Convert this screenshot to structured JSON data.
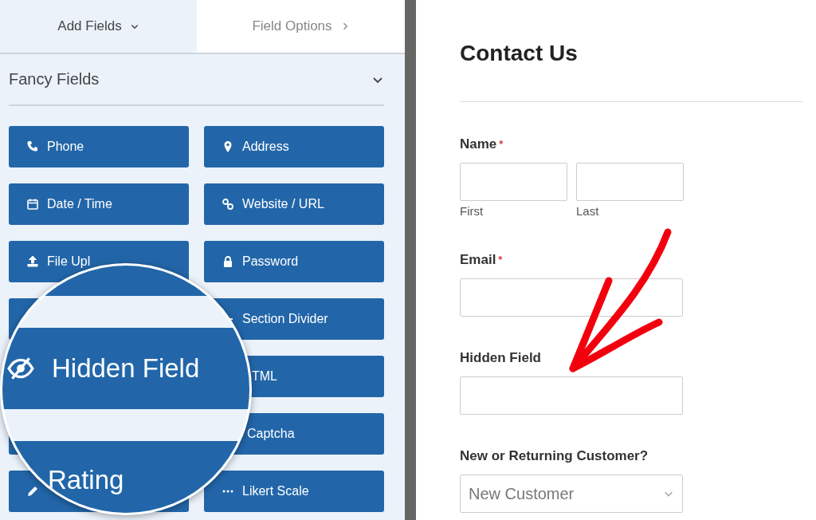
{
  "tabs": [
    {
      "label": "Add Fields",
      "selected": true
    },
    {
      "label": "Field Options",
      "selected": false
    }
  ],
  "section": {
    "title": "Fancy Fields",
    "expanded": true
  },
  "field_buttons": [
    {
      "kind": "phone",
      "label": "Phone"
    },
    {
      "kind": "address",
      "label": "Address"
    },
    {
      "kind": "date",
      "label": "Date / Time"
    },
    {
      "kind": "website",
      "label": "Website / URL"
    },
    {
      "kind": "upload",
      "label": "File Upl"
    },
    {
      "kind": "password",
      "label": "Password"
    },
    {
      "kind": "blank"
    },
    {
      "kind": "divider",
      "label": "Section Divider"
    },
    {
      "kind": "covered"
    },
    {
      "kind": "html",
      "label": "TML"
    },
    {
      "kind": "blank"
    },
    {
      "kind": "captcha",
      "label": "Captcha"
    },
    {
      "kind": "rating"
    },
    {
      "kind": "likert",
      "label": "Likert Scale"
    }
  ],
  "magnifier": {
    "buttons": [
      {
        "kind": "hidden",
        "label": "Hidden Field"
      },
      {
        "kind": "rating",
        "label": "Rating"
      }
    ]
  },
  "form": {
    "title": "Contact Us",
    "fields": [
      {
        "kind": "name",
        "label": "Name",
        "required_mark": "*",
        "sublabels": [
          "First",
          "Last"
        ]
      },
      {
        "kind": "text",
        "label": "Email",
        "required_mark": "*"
      },
      {
        "kind": "text",
        "label": "Hidden Field"
      },
      {
        "kind": "select",
        "label": "New or Returning Customer?",
        "value": "New Customer"
      }
    ]
  }
}
